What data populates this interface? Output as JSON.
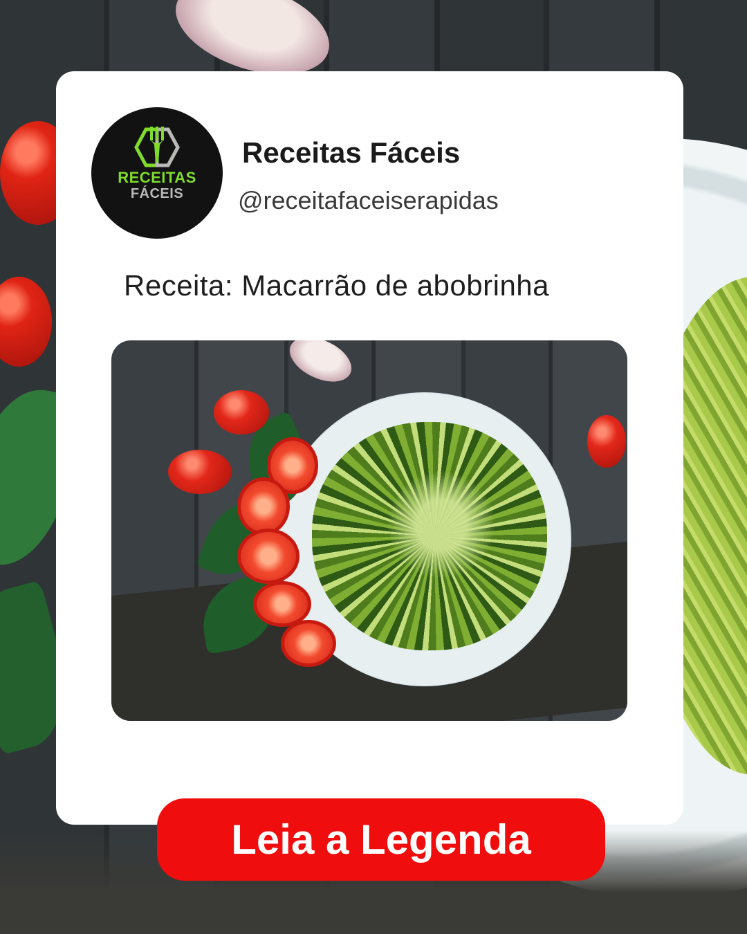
{
  "profile": {
    "name": "Receitas Fáceis",
    "handle": "@receitafaceiserapidas",
    "logo": {
      "line1": "RECEITAS",
      "line2": "FÁCEIS",
      "icon": "fork-hexagon-icon",
      "colors": {
        "primary": "#7fdc2c",
        "secondary": "#b9b9b9",
        "background": "#121212"
      }
    }
  },
  "post": {
    "title": "Receita: Macarrão de abobrinha",
    "image_alt": "Macarrão de abobrinha com tomates"
  },
  "cta": {
    "label": "Leia a Legenda",
    "color": "#ef0d0d"
  }
}
